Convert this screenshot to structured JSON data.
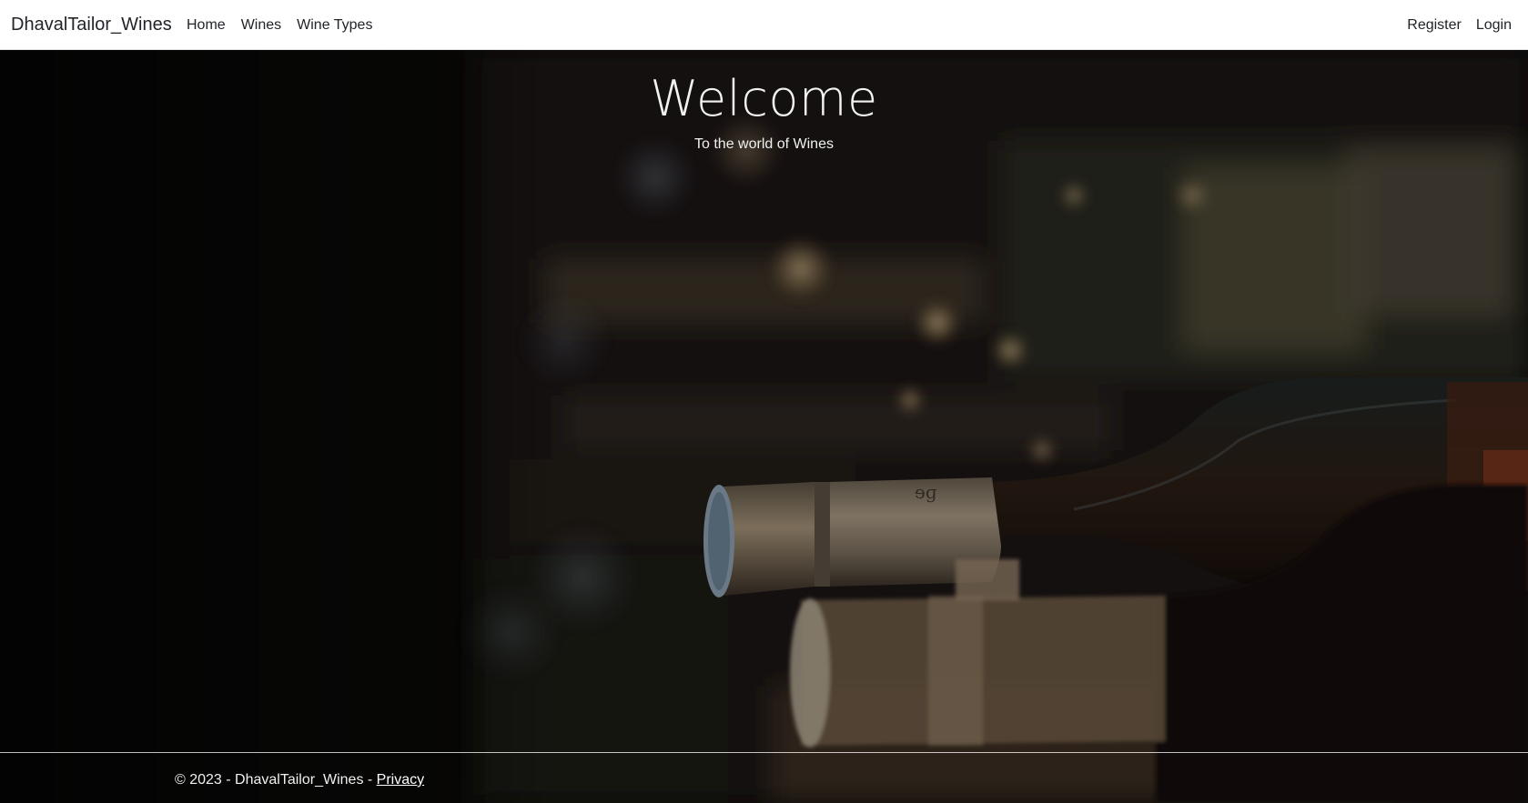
{
  "navbar": {
    "brand": "DhavalTailor_Wines",
    "left_links": [
      "Home",
      "Wines",
      "Wine Types"
    ],
    "right_links": [
      "Register",
      "Login"
    ]
  },
  "hero": {
    "title": "Welcome",
    "subtitle": "To the world of Wines",
    "background_image": "dark photo of wine bottles lying on a rack"
  },
  "footer": {
    "copyright": "© 2023 - DhavalTailor_Wines - ",
    "privacy_link": "Privacy"
  },
  "colors": {
    "navbar_bg": "#ffffff",
    "text_dark": "#212529",
    "hero_text": "#f2f2f2"
  }
}
